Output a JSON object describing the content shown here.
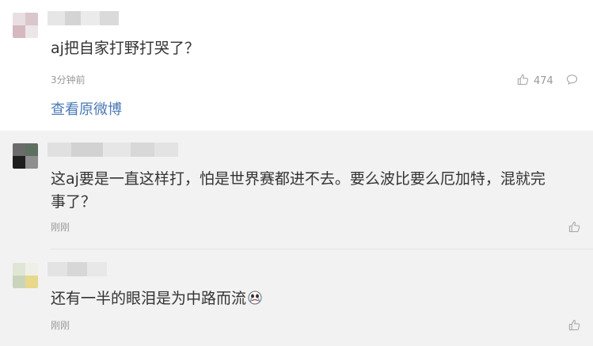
{
  "comments": [
    {
      "text": "aj把自家打野打哭了？",
      "time": "3分钟前",
      "likes": "474",
      "view_original": "查看原微博"
    },
    {
      "text_line1": "这aj要是一直这样打，怕是世界赛都进不去。要么波比要么厄加特，混就完",
      "text_line2": "事了？",
      "time": "刚刚"
    },
    {
      "text": "还有一半的眼泪是为中路而流",
      "time": "刚刚"
    }
  ],
  "icons": {
    "like": "thumbs-up-icon",
    "reply": "comment-bubble-icon",
    "emoji": "crying-face-emoji"
  },
  "colors": {
    "link": "#4a7ab6",
    "meta": "#999999",
    "text": "#333333"
  }
}
